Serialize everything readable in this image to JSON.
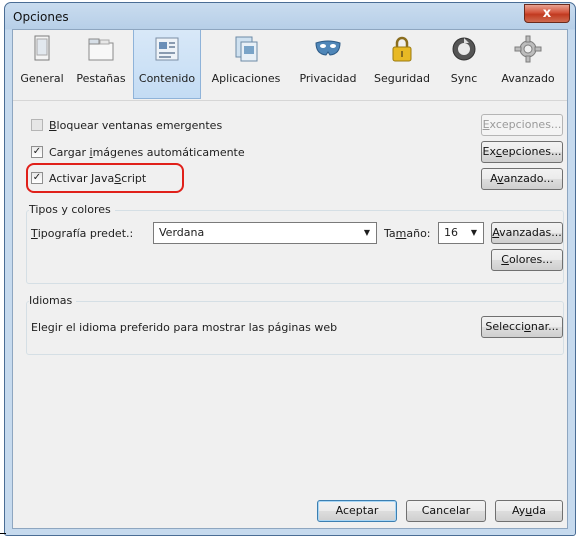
{
  "window": {
    "title": "Opciones",
    "close_glyph": "x"
  },
  "tabs": [
    {
      "label": "General",
      "icon": "window-icon"
    },
    {
      "label": "Pestañas",
      "icon": "tabs-icon"
    },
    {
      "label": "Contenido",
      "icon": "content-icon",
      "selected": true
    },
    {
      "label": "Aplicaciones",
      "icon": "applications-icon"
    },
    {
      "label": "Privacidad",
      "icon": "mask-icon"
    },
    {
      "label": "Seguridad",
      "icon": "padlock-icon"
    },
    {
      "label": "Sync",
      "icon": "sync-icon"
    },
    {
      "label": "Avanzado",
      "icon": "gear-icon"
    }
  ],
  "content": {
    "popups": {
      "pre": "",
      "key": "B",
      "post": "loquear ventanas emergentes",
      "checked": false,
      "button": {
        "pre": "",
        "key": "E",
        "post": "xcepciones...",
        "enabled": false
      }
    },
    "images": {
      "pre": "Cargar ",
      "key": "i",
      "post": "mágenes automáticamente",
      "checked": true,
      "button": {
        "pre": "Ex",
        "key": "c",
        "post": "epciones...",
        "enabled": true
      }
    },
    "javascript": {
      "pre": "Activar Java",
      "key": "S",
      "post": "cript",
      "checked": true,
      "button": {
        "pre": "A",
        "key": "v",
        "post": "anzado...",
        "enabled": true
      }
    },
    "check_glyph": "✓",
    "fonts": {
      "group_label": "Tipos y colores",
      "font_label_key": "T",
      "font_label_rest": "ipografía predet.:",
      "font_value": "Verdana",
      "size_label_pre": "Ta",
      "size_label_key": "m",
      "size_label_post": "año:",
      "size_value": "16",
      "arrow_glyph": "▼",
      "advanced_pre": "",
      "advanced_key": "A",
      "advanced_post": "vanzadas...",
      "colors_pre": "",
      "colors_key": "C",
      "colors_post": "olores..."
    },
    "languages": {
      "group_label": "Idiomas",
      "description": "Elegir el idioma preferido para mostrar las páginas web",
      "button_pre": "Selecci",
      "button_key": "o",
      "button_post": "nar..."
    }
  },
  "footer": {
    "ok": "Aceptar",
    "cancel": "Cancelar",
    "help_pre": "Ay",
    "help_key": "u",
    "help_post": "da"
  },
  "colors": {
    "highlight": "#e0201a",
    "selected_tab": "#c4dcf4",
    "titlebar": "#c9dcef"
  }
}
